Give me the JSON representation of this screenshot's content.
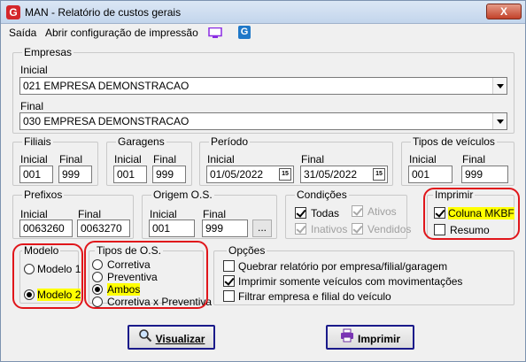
{
  "window": {
    "title": "MAN -  Relatório de custos gerais",
    "close_label": "X",
    "logo_letter": "G"
  },
  "menu": {
    "items": [
      "Saída",
      "Abrir configuração de impressão"
    ],
    "g_icon_letter": "G"
  },
  "empresas": {
    "legend": "Empresas",
    "inicial_label": "Inicial",
    "inicial_value": "021 EMPRESA DEMONSTRACAO",
    "final_label": "Final",
    "final_value": "030 EMPRESA DEMONSTRACAO"
  },
  "filiais": {
    "legend": "Filiais",
    "inicial_label": "Inicial",
    "inicial_value": "001",
    "final_label": "Final",
    "final_value": "999"
  },
  "garagens": {
    "legend": "Garagens",
    "inicial_label": "Inicial",
    "inicial_value": "001",
    "final_label": "Final",
    "final_value": "999"
  },
  "periodo": {
    "legend": "Período",
    "inicial_label": "Inicial",
    "inicial_value": "01/05/2022",
    "final_label": "Final",
    "final_value": "31/05/2022",
    "cal_label": "15"
  },
  "tipos_veiculos": {
    "legend": "Tipos de veículos",
    "inicial_label": "Inicial",
    "inicial_value": "001",
    "final_label": "Final",
    "final_value": "999"
  },
  "prefixos": {
    "legend": "Prefixos",
    "inicial_label": "Inicial",
    "inicial_value": "0063260",
    "final_label": "Final",
    "final_value": "0063270"
  },
  "origem": {
    "legend": "Origem O.S.",
    "inicial_label": "Inicial",
    "inicial_value": "001",
    "final_label": "Final",
    "final_value": "999",
    "dots_label": "..."
  },
  "condicoes": {
    "legend": "Condições",
    "todas": "Todas",
    "ativos": "Ativos",
    "inativos": "Inativos",
    "vendidos": "Vendidos"
  },
  "imprimir_group": {
    "legend": "Imprimir",
    "coluna": "Coluna MKBF",
    "resumo": "Resumo"
  },
  "modelo": {
    "legend": "Modelo",
    "modelo1": "Modelo 1",
    "modelo2": "Modelo 2"
  },
  "tipos_os": {
    "legend": "Tipos de O.S.",
    "corretiva": "Corretiva",
    "preventiva": "Preventiva",
    "ambos": "Ambos",
    "corr_prev": "Corretiva x Preventiva"
  },
  "opcoes": {
    "legend": "Opções",
    "quebrar": "Quebrar relatório por empresa/filial/garagem",
    "somente": "Imprimir somente veículos com movimentações",
    "filtrar": "Filtrar empresa e filial do veículo"
  },
  "buttons": {
    "visualizar": "Visualizar",
    "imprimir": "Imprimir"
  },
  "colors": {
    "highlight": "#ffff00",
    "annotation": "#e0161b",
    "brand_red": "#d4262b",
    "brand_blue": "#1f78c8"
  }
}
